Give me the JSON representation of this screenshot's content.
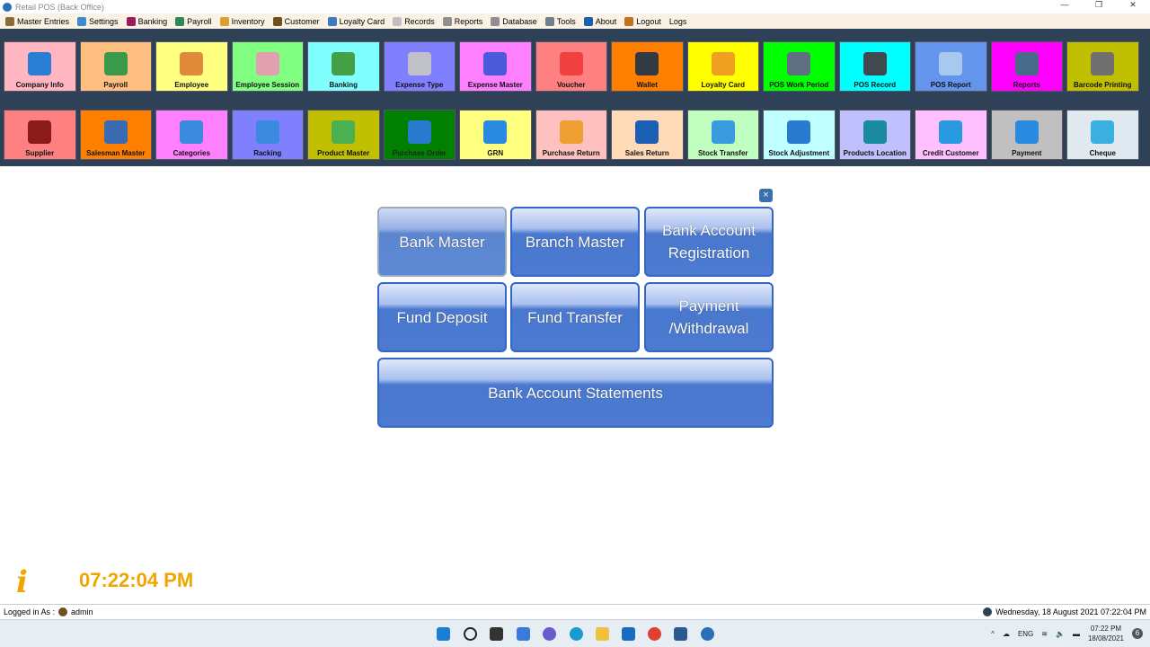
{
  "window": {
    "title": "Retail POS (Back Office)"
  },
  "menu": [
    {
      "label": "Master Entries",
      "color": "#8a6d3b"
    },
    {
      "label": "Settings",
      "color": "#3c8dd0"
    },
    {
      "label": "Banking",
      "color": "#a0195a"
    },
    {
      "label": "Payroll",
      "color": "#2a8a5a"
    },
    {
      "label": "Inventory",
      "color": "#d8a030"
    },
    {
      "label": "Customer",
      "color": "#705020"
    },
    {
      "label": "Loyalty Card",
      "color": "#3a7ac0"
    },
    {
      "label": "Records",
      "color": "#c0c0c0"
    },
    {
      "label": "Reports",
      "color": "#909090"
    },
    {
      "label": "Database",
      "color": "#909090"
    },
    {
      "label": "Tools",
      "color": "#708090"
    },
    {
      "label": "About",
      "color": "#1a5fb4"
    },
    {
      "label": "Logout",
      "color": "#c07020"
    },
    {
      "label": "Logs",
      "color": ""
    }
  ],
  "tiles_row1": [
    {
      "label": "Company Info",
      "bg": "#ffb6c1",
      "icon": "#2a7fd4"
    },
    {
      "label": "Payroll",
      "bg": "#ffbf80",
      "icon": "#3a9a4a"
    },
    {
      "label": "Employee",
      "bg": "#ffff80",
      "icon": "#e08a3a"
    },
    {
      "label": "Employee Session",
      "bg": "#80ff80",
      "icon": "#e0a0b0"
    },
    {
      "label": "Banking",
      "bg": "#80ffff",
      "icon": "#43a047"
    },
    {
      "label": "Expense Type",
      "bg": "#8080ff",
      "icon": "#c0c0c8"
    },
    {
      "label": "Expense Master",
      "bg": "#ff80ff",
      "icon": "#4a5ad8"
    },
    {
      "label": "Voucher",
      "bg": "#ff8080",
      "icon": "#f04040"
    },
    {
      "label": "Wallet",
      "bg": "#ff8000",
      "icon": "#333a44"
    },
    {
      "label": "Loyalty Card",
      "bg": "#ffff00",
      "icon": "#f0a020"
    },
    {
      "label": "POS Work Period",
      "bg": "#00ff00",
      "icon": "#607080"
    },
    {
      "label": "POS Record",
      "bg": "#00ffff",
      "icon": "#404850"
    },
    {
      "label": "POS Report",
      "bg": "#6495ed",
      "icon": "#a8c8f0"
    },
    {
      "label": "Reports",
      "bg": "#ff00ff",
      "icon": "#4a6a8a"
    },
    {
      "label": "Barcode Printing",
      "bg": "#c0c000",
      "icon": "#707070"
    }
  ],
  "tiles_row2": [
    {
      "label": "Supplier",
      "bg": "#ff8080",
      "icon": "#8b1a1a"
    },
    {
      "label": "Salesman Master",
      "bg": "#ff8000",
      "icon": "#3a6ab0"
    },
    {
      "label": "Categories",
      "bg": "#ff80ff",
      "icon": "#3a8ae0"
    },
    {
      "label": "Racking",
      "bg": "#8080ff",
      "icon": "#3a8ae0"
    },
    {
      "label": "Product Master",
      "bg": "#c0c000",
      "icon": "#4caf50"
    },
    {
      "label": "Purchase Order",
      "bg": "#008000",
      "icon": "#2a7ad0"
    },
    {
      "label": "GRN",
      "bg": "#ffff80",
      "icon": "#2a8ae0"
    },
    {
      "label": "Purchase Return",
      "bg": "#ffc0c0",
      "icon": "#f0a030"
    },
    {
      "label": "Sales Return",
      "bg": "#ffdab9",
      "icon": "#1a5fb4"
    },
    {
      "label": "Stock Transfer",
      "bg": "#c0ffc0",
      "icon": "#3a9ae0"
    },
    {
      "label": "Stock Adjustment",
      "bg": "#c0ffff",
      "icon": "#2a7ad0"
    },
    {
      "label": "Products Location",
      "bg": "#c0c0ff",
      "icon": "#1a8aa0"
    },
    {
      "label": "Credit Customer",
      "bg": "#ffc0ff",
      "icon": "#2a9ae0"
    },
    {
      "label": "Payment",
      "bg": "#c0c0c0",
      "icon": "#2a8ae0"
    },
    {
      "label": "Cheque",
      "bg": "#e0e8f0",
      "icon": "#3ab0e0"
    }
  ],
  "banking_panel": {
    "close": "×",
    "buttons": [
      "Bank Master",
      "Branch Master",
      "Bank Account Registration",
      "Fund Deposit",
      "Fund Transfer",
      "Payment /Withdrawal",
      "Bank Account Statements"
    ]
  },
  "info_icon": "i",
  "clock": "07:22:04 PM",
  "status": {
    "logged_in_label": "Logged in As :",
    "user": "admin",
    "datetime": "Wednesday, 18 August 2021 07:22:04 PM"
  },
  "taskbar": {
    "lang": "ENG",
    "time": "07:22 PM",
    "date": "18/08/2021",
    "notifications": "6"
  }
}
